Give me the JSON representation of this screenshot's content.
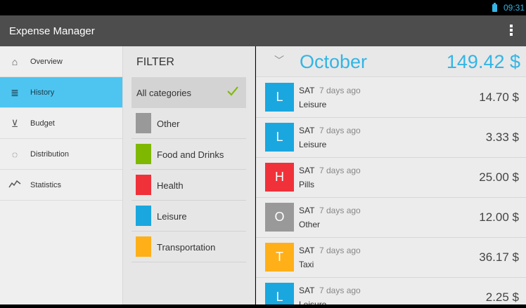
{
  "status_bar": {
    "time": "09:31"
  },
  "app": {
    "title": "Expense Manager"
  },
  "nav": {
    "items": [
      {
        "label": "Overview",
        "icon": "home-icon"
      },
      {
        "label": "History",
        "icon": "list-icon"
      },
      {
        "label": "Budget",
        "icon": "budget-icon"
      },
      {
        "label": "Distribution",
        "icon": "pie-icon"
      },
      {
        "label": "Statistics",
        "icon": "chart-icon"
      }
    ],
    "active_index": 1,
    "active_color": "#4dc5f0"
  },
  "filter": {
    "title": "FILTER",
    "items": [
      {
        "label": "All categories",
        "selected": true
      },
      {
        "label": "Other",
        "color": "#999999"
      },
      {
        "label": "Food and Drinks",
        "color": "#7fb800"
      },
      {
        "label": "Health",
        "color": "#f0313a"
      },
      {
        "label": "Leisure",
        "color": "#1aa7df"
      },
      {
        "label": "Transportation",
        "color": "#ffb018"
      }
    ]
  },
  "month": {
    "name": "October",
    "total": "149.42 $"
  },
  "transactions": [
    {
      "letter": "L",
      "day": "SAT",
      "ago": "7 days ago",
      "category": "Leisure",
      "amount": "14.70 $",
      "color": "#1aa7df"
    },
    {
      "letter": "L",
      "day": "SAT",
      "ago": "7 days ago",
      "category": "Leisure",
      "amount": "3.33 $",
      "color": "#1aa7df"
    },
    {
      "letter": "H",
      "day": "SAT",
      "ago": "7 days ago",
      "category": "Pills",
      "amount": "25.00 $",
      "color": "#f0313a"
    },
    {
      "letter": "O",
      "day": "SAT",
      "ago": "7 days ago",
      "category": "Other",
      "amount": "12.00 $",
      "color": "#999999"
    },
    {
      "letter": "T",
      "day": "SAT",
      "ago": "7 days ago",
      "category": "Taxi",
      "amount": "36.17 $",
      "color": "#ffb018"
    },
    {
      "letter": "L",
      "day": "SAT",
      "ago": "7 days ago",
      "category": "Leisure",
      "amount": "2.25 $",
      "color": "#1aa7df"
    }
  ],
  "accent_color": "#33b5e5"
}
